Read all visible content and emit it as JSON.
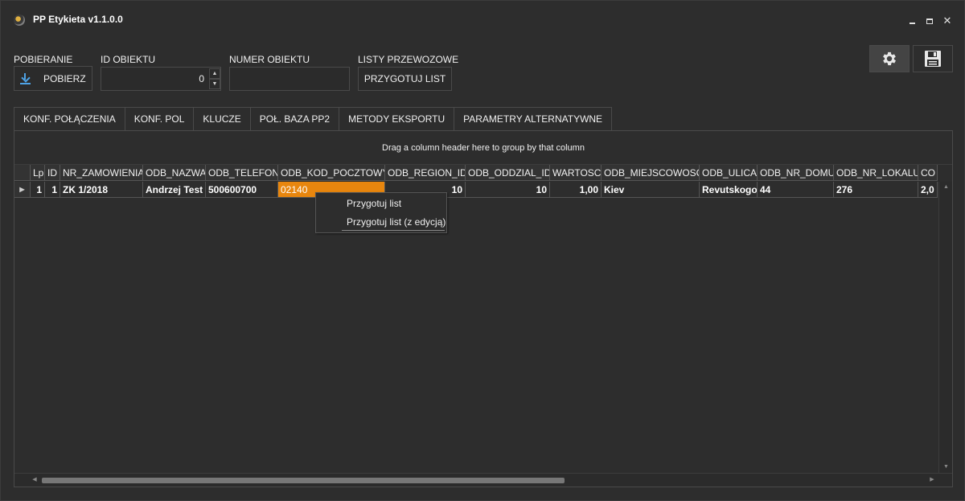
{
  "window": {
    "title": "PP Etykieta v1.1.0.0"
  },
  "toolbar": {
    "pobieranie_label": "POBIERANIE",
    "pobierz_label": "POBIERZ",
    "id_obiektu_label": "ID OBIEKTU",
    "id_obiektu_value": "0",
    "numer_obiektu_label": "NUMER OBIEKTU",
    "numer_obiektu_value": "",
    "listy_label": "LISTY PRZEWOZOWE",
    "przygotuj_label": "PRZYGOTUJ LIST"
  },
  "tabs": [
    {
      "label": "KONF. POŁĄCZENIA"
    },
    {
      "label": "KONF. POL"
    },
    {
      "label": "KLUCZE"
    },
    {
      "label": "POŁ. BAZA PP2"
    },
    {
      "label": "METODY EKSPORTU"
    },
    {
      "label": "PARAMETRY ALTERNATYWNE"
    }
  ],
  "grid": {
    "group_hint": "Drag a column header here to group by that column",
    "columns": [
      "Lp",
      "ID",
      "NR_ZAMOWIENIA",
      "ODB_NAZWA",
      "ODB_TELEFON",
      "ODB_KOD_POCZTOWY",
      "ODB_REGION_ID",
      "ODB_ODDZIAL_ID",
      "WARTOSC",
      "ODB_MIEJSCOWOSC",
      "ODB_ULICA",
      "ODB_NR_DOMU",
      "ODB_NR_LOKALU",
      "CO"
    ],
    "rows": [
      [
        "1",
        "1",
        "ZK 1/2018",
        "Andrzej Test",
        "500600700",
        "02140",
        "10",
        "10",
        "1,00",
        "Kiev",
        "Revutskogo",
        "44",
        "276",
        "2,0"
      ]
    ],
    "selected_color": "#e8860e"
  },
  "context_menu": {
    "items": [
      {
        "label": "Przygotuj list"
      },
      {
        "label": "Przygotuj list (z edycją)"
      }
    ]
  },
  "icons": {
    "settings": "gear-icon",
    "save": "floppy-disk-icon",
    "download": "download-icon"
  }
}
